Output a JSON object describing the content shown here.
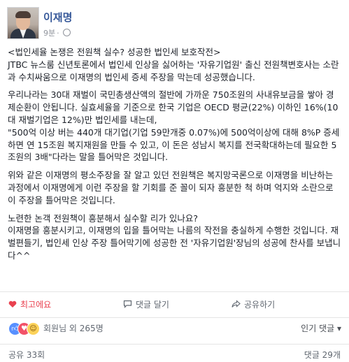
{
  "post": {
    "author": "이재명",
    "time": "9분",
    "separator": "·",
    "paragraphs": [
      "<법인세율 논쟁은 전원책 실수? 성공한 법인세 보호작전>\nJTBC 뉴스룸 신년토론에서 법인세 인상을 싫어하는 '자유기업원' 출신 전원책변호사는 소란과 수치싸움으로 이재명의 법인세 증세 주장을 막는데 성공했습니다.",
      "우리나라는 30대 재벌이 국민총생산액의 절반에 가까운 750조원의 사내유보금을 쌓아 경제순환이 안됩니다. 실효세율을 기준으로 한국 기업은 OECD 평균(22%) 이하인 16%(10대 재벌기업은 12%)만 법인세를 내는데,\n\"500억 이상 버는 440개 대기업(기업 59만개중 0.07%)에 500억이상에 대해 8%P 증세하면 연 15조원 복지재원을 만들 수 있고, 이 돈은 성남시 복지를 전국확대하는데 필요한 5조원의 3배\"다라는 말을 틀어막은 것입니다.",
      "위와 같은 이재명의 평소주장을 잘 알고 있던 전원책은 복지망국론으로 이재명을 비난하는 과정에서 이재명에게 이런 주장을 할 기회를 준 꼴이 되자 흥분한 척 하며 억지와 소란으로 이 주장을 틀어막은 것입니다.",
      "노련한 논객 전원책이 흥분해서 실수할 리가 있나요?\n이재명을 흥분시키고, 이재명의 입을 틀어막는 나름의 작전을 충실하게 수행한 것입니다. 재벌편들기, 법인세 인상 주장 틀어막기에 성공한 전 '자유기업원'장님의 성공에 찬사를 보냅니다^^"
    ]
  },
  "actions": {
    "like": "최고에요",
    "comment": "댓글 달기",
    "share": "공유하기"
  },
  "reactions": {
    "text": "회원님 외 265명",
    "sort": "인기 댓글 ▾"
  },
  "footer": {
    "shares": "공유 33회",
    "comments": "댓글 29개"
  },
  "colors": {
    "author": "#365899",
    "love_active": "#e9414f"
  }
}
